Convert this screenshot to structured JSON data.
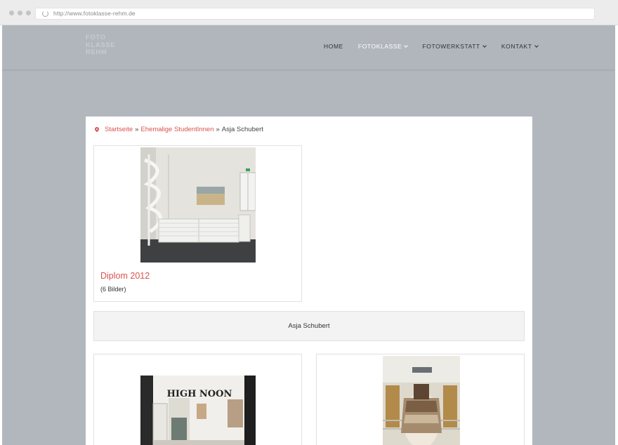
{
  "browser": {
    "url": "http://www.fotoklasse-rehm.de"
  },
  "site": {
    "logo_lines": [
      "FOTO",
      "KLASSE",
      "REHM"
    ],
    "nav": [
      {
        "label": "HOME",
        "dropdown": false,
        "active": false
      },
      {
        "label": "FOTOKLASSE",
        "dropdown": true,
        "active": true
      },
      {
        "label": "FOTOWERKSTATT",
        "dropdown": true,
        "active": false
      },
      {
        "label": "KONTAKT",
        "dropdown": true,
        "active": false
      }
    ]
  },
  "breadcrumb": {
    "items": [
      "Startseite",
      "Ehemalige StudentInnen",
      "Asja Schubert"
    ],
    "separator": "»"
  },
  "albums": [
    {
      "title": "Diplom 2012",
      "count": "(6 Bilder)",
      "thumbnail": "gallery-room-spiral-staircase-photo"
    }
  ],
  "section": {
    "title": "Asja Schubert"
  },
  "gallery": [
    {
      "thumbnail": "high-noon-exhibition-photo",
      "sign_text": "HIGH NOON"
    },
    {
      "thumbnail": "horse-with-blanket-photo"
    }
  ],
  "colors": {
    "accent": "#d9534f",
    "page_background": "#b2b7be",
    "nav_active": "#ffffff"
  }
}
